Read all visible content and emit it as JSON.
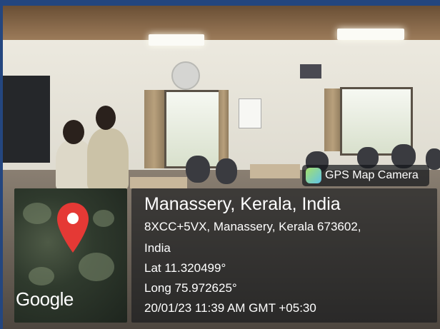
{
  "badge": {
    "label": "GPS Map Camera",
    "icon": "gps-map-camera-icon"
  },
  "map": {
    "provider_logo": "Google",
    "pin_icon": "map-pin-icon",
    "pin_color": "#e53935"
  },
  "location": {
    "title": "Manassery, Kerala, India",
    "address_line_1": "8XCC+5VX, Manassery, Kerala 673602,",
    "address_line_2": "India",
    "latitude": "Lat 11.320499°",
    "longitude": "Long 75.972625°",
    "timestamp": "20/01/23 11:39 AM GMT +05:30"
  },
  "colors": {
    "frame_border": "#24467f",
    "panel_bg": "rgba(20,22,26,0.62)",
    "text": "#ffffff"
  }
}
